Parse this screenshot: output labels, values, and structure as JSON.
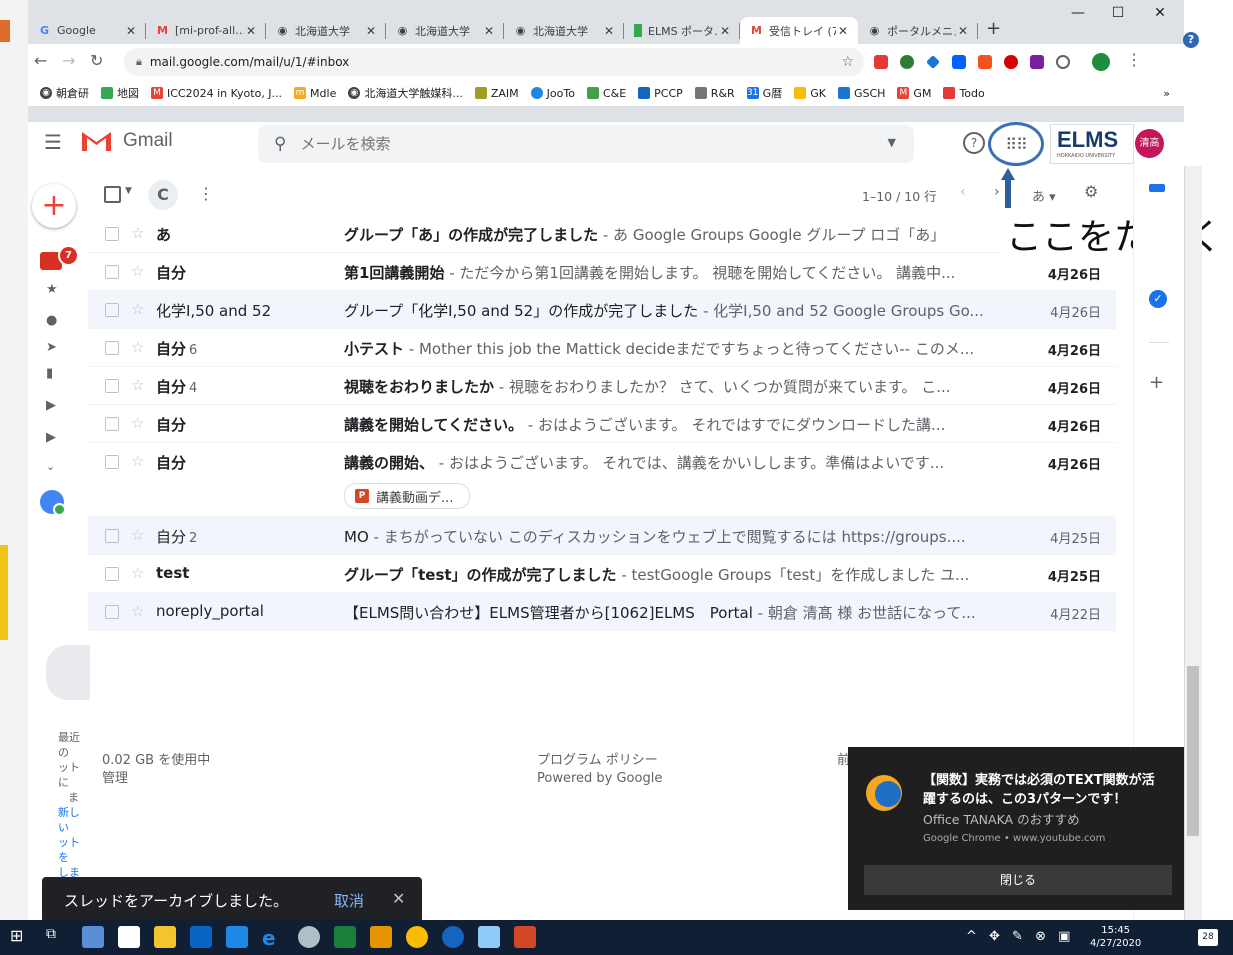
{
  "browser": {
    "tabs": [
      {
        "label": "Google",
        "icon": "google-g-icon"
      },
      {
        "label": "[mi-prof-all…",
        "icon": "gmail-m-icon"
      },
      {
        "label": "北海道大学",
        "icon": "globe-icon"
      },
      {
        "label": "北海道大学",
        "icon": "globe-icon"
      },
      {
        "label": "北海道大学",
        "icon": "globe-icon"
      },
      {
        "label": "ELMS ポータ…",
        "icon": "elms-icon"
      },
      {
        "label": "受信トレイ (7…",
        "icon": "gmail-m-icon"
      },
      {
        "label": "ポータルメニュ…",
        "icon": "globe-icon"
      }
    ],
    "new_tab": "+",
    "url": "mail.google.com/mail/u/1/#inbox",
    "bookmarks": [
      "朝倉研",
      "地図",
      "ICC2024 in Kyoto, J...",
      "Mdle",
      "北海道大学触媒科...",
      "ZAIM",
      "JooTo",
      "C&E",
      "PCCP",
      "R&R",
      "G暦",
      "GK",
      "GSCH",
      "GM",
      "Todo"
    ],
    "bookmarks_more": "»"
  },
  "gmail": {
    "app_name": "Gmail",
    "search_placeholder": "メールを検索",
    "avatar_text": "清高",
    "elms_logo": "ELMS",
    "elms_sub": "HOKKAIDO UNIVERSITY",
    "inbox_badge": "7",
    "list": {
      "range": "1–10 / 10 行",
      "lang": "あ ▾"
    },
    "emails": [
      {
        "sender": "あ",
        "count": "",
        "subject": "グループ「あ」の作成が完了しました",
        "snippet": " - あ Google Groups Google グループ ロゴ「あ」",
        "date": "",
        "unread": true
      },
      {
        "sender": "自分",
        "count": "",
        "subject": "第1回講義開始",
        "snippet": " - ただ今から第1回講義を開始します。 視聴を開始してください。 講義中...",
        "date": "4月26日",
        "unread": true
      },
      {
        "sender": "化学I,50 and 52",
        "count": "",
        "subject": "グループ「化学I,50 and 52」の作成が完了しました",
        "snippet": " - 化学I,50 and 52 Google Groups Go...",
        "date": "4月26日",
        "unread": false
      },
      {
        "sender": "自分",
        "count": "6",
        "subject": "小テスト",
        "snippet": " - Mother this job the Mattick decideまだですちょっと待ってください-- このメ...",
        "date": "4月26日",
        "unread": true
      },
      {
        "sender": "自分",
        "count": "4",
        "subject": "視聴をおわりましたか",
        "snippet": " - 視聴をおわりましたか？ さて、いくつか質問が来ています。 こ...",
        "date": "4月26日",
        "unread": true
      },
      {
        "sender": "自分",
        "count": "",
        "subject": "講義を開始してください。",
        "snippet": " - おはようございます。 それではすでにダウンロードした講...",
        "date": "4月26日",
        "unread": true
      },
      {
        "sender": "自分",
        "count": "",
        "subject": "講義の開始、",
        "snippet": " - おはようございます。 それでは、講義をかいしします。準備はよいです...",
        "date": "4月26日",
        "unread": true,
        "attachment": "講義動画デ..."
      },
      {
        "sender": "自分",
        "count": "2",
        "subject": "MO",
        "snippet": " - まちがっていない このディスカッションをウェブ上で閲覧するには https://groups....",
        "date": "4月25日",
        "unread": false
      },
      {
        "sender": "test",
        "count": "",
        "subject": "グループ「test」の作成が完了しました",
        "snippet": " - testGoogle Groups「test」を作成しました ユ...",
        "date": "4月25日",
        "unread": true
      },
      {
        "sender": "noreply_portal",
        "count": "",
        "subject": "【ELMS問い合わせ】ELMS管理者から[1062]ELMS　Portal",
        "snippet": " - 朝倉 清髙 様 お世話になって...",
        "date": "4月22日",
        "unread": false
      }
    ],
    "footer": {
      "storage": "0.02 GB を使用中",
      "manage": "管理",
      "policy": "プログラム ポリシー",
      "powered": "Powered by Google",
      "cut": "前"
    },
    "left_cut": [
      "最近の",
      "ットに",
      "ま",
      "新しい",
      "ットを",
      "しま"
    ]
  },
  "callout": "ここをたたく",
  "snackbar": {
    "message": "スレッドをアーカイブしました。",
    "undo": "取消",
    "close": "✕"
  },
  "notification": {
    "title": "【関数】実務では必須のTEXT関数が活躍するのは、この3パターンです！",
    "source": "Office TANAKA のおすすめ",
    "footer": "Google Chrome • www.youtube.com",
    "button": "閉じる"
  },
  "taskbar": {
    "time": "15:45",
    "date": "4/27/2020",
    "notifications": "28"
  },
  "colors": {
    "gmail_red": "#ea4335",
    "highlight_ring": "#3a6fb5",
    "taskbar": "#101f33"
  }
}
